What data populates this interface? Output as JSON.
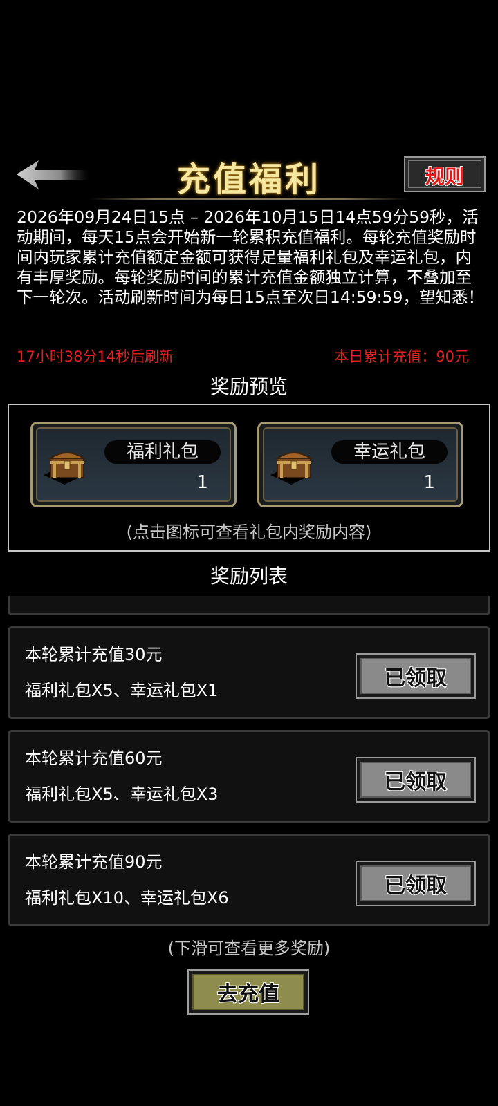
{
  "header": {
    "title": "充值福利",
    "rules_label": "规则",
    "back_icon": "back-arrow-icon"
  },
  "description": "2026年09月24日15点 – 2026年10月15日14点59分59秒，活动期间，每天15点会开始新一轮累积充值福利。每轮充值奖励时间内玩家累计充值额定金额可获得足量福利礼包及幸运礼包，内有丰厚奖励。每轮奖励时间的累计充值金额独立计算，不叠加至下一轮次。活动刷新时间为每日15点至次日14:59:59，望知悉！",
  "status": {
    "countdown": "17小时38分14秒后刷新",
    "today_recharge": "本日累计充值：90元"
  },
  "preview": {
    "title": "奖励预览",
    "packs": [
      {
        "name": "福利礼包",
        "count": "1",
        "icon": "treasure-chest-icon"
      },
      {
        "name": "幸运礼包",
        "count": "1",
        "icon": "treasure-chest-icon"
      }
    ],
    "hint": "(点击图标可查看礼包内奖励内容)"
  },
  "reward_list": {
    "title": "奖励列表",
    "items": [
      {
        "requirement": "本轮累计充值30元",
        "rewards": "福利礼包X5、幸运礼包X1",
        "button": "已领取"
      },
      {
        "requirement": "本轮累计充值60元",
        "rewards": "福利礼包X5、幸运礼包X3",
        "button": "已领取"
      },
      {
        "requirement": "本轮累计充值90元",
        "rewards": "福利礼包X10、幸运礼包X6",
        "button": "已领取"
      }
    ],
    "scroll_hint": "(下滑可查看更多奖励)"
  },
  "recharge_button": "去充值",
  "colors": {
    "title_gold": "#f5e6a0",
    "alert_red": "#e02020",
    "button_grey": "#8a8a8a",
    "button_olive": "#8f8d4e"
  }
}
